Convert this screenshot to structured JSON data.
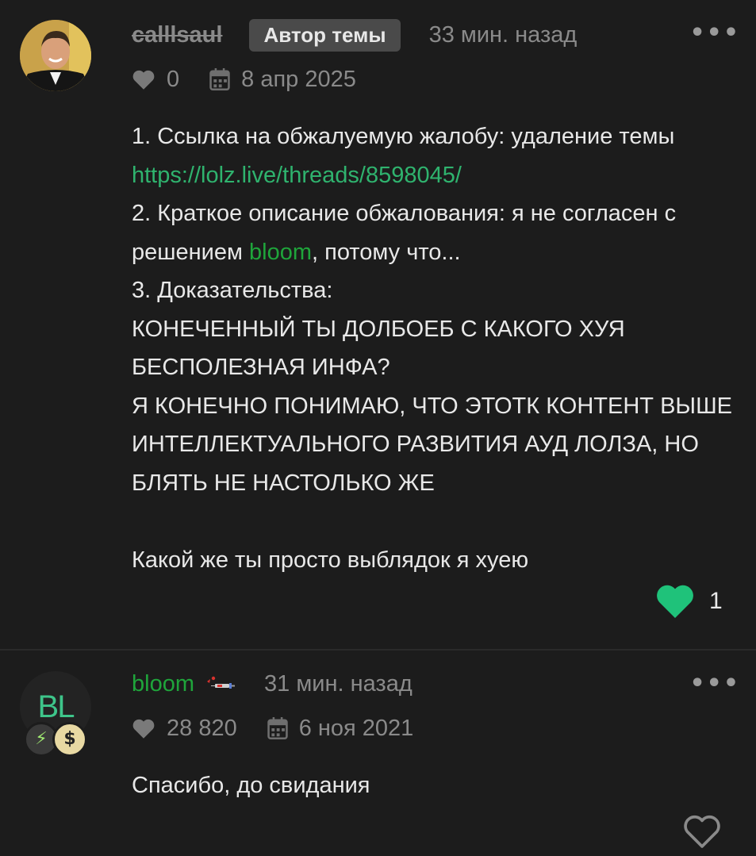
{
  "posts": [
    {
      "username": "calllsaul",
      "author_badge": "Автор темы",
      "time_ago": "33 мин. назад",
      "menu_icon": "more-horizontal-icon",
      "likes": "0",
      "registered": "8 апр 2025",
      "content": {
        "line1_prefix": "1. Ссылка на обжалуемую жалобу: удаление темы ",
        "link": "https://lolz.live/threads/8598045/",
        "line2_prefix": "2. Краткое описание обжалования: я не согласен с решением ",
        "mention": "bloom",
        "line2_suffix": ", потому что...",
        "line3": "3. Доказательства:",
        "line4": "КОНЕЧЕННЫЙ ТЫ ДОЛБОЕБ С КАКОГО ХУЯ БЕСПОЛЕЗНАЯ ИНФА?",
        "line5": "Я КОНЕЧНО ПОНИМАЮ, ЧТО ЭТОТК КОНТЕНТ ВЫШЕ ИНТЕЛЛЕКТУАЛЬНОГО РАЗВИТИЯ АУД ЛОЛЗА, НО БЛЯТЬ НЕ НАСТОЛЬКО ЖЕ",
        "line6": "Какой же ты просто выблядок я хуею"
      },
      "post_likes": "1",
      "liked": true,
      "colors": {
        "like": "#1fc27a"
      }
    },
    {
      "username": "bloom",
      "avatar_text": "BL",
      "badge_bolt": "⚡",
      "badge_dollar": "$",
      "time_ago": "31 мин. назад",
      "menu_icon": "more-horizontal-icon",
      "likes": "28 820",
      "registered": "6 ноя 2021",
      "content": {
        "line1": "Спасибо, до свидания"
      },
      "liked": false
    }
  ],
  "colors": {
    "background": "#1c1c1c",
    "link": "#2fb36e",
    "username_green": "#1fa53b",
    "muted": "#8a8a8a"
  }
}
